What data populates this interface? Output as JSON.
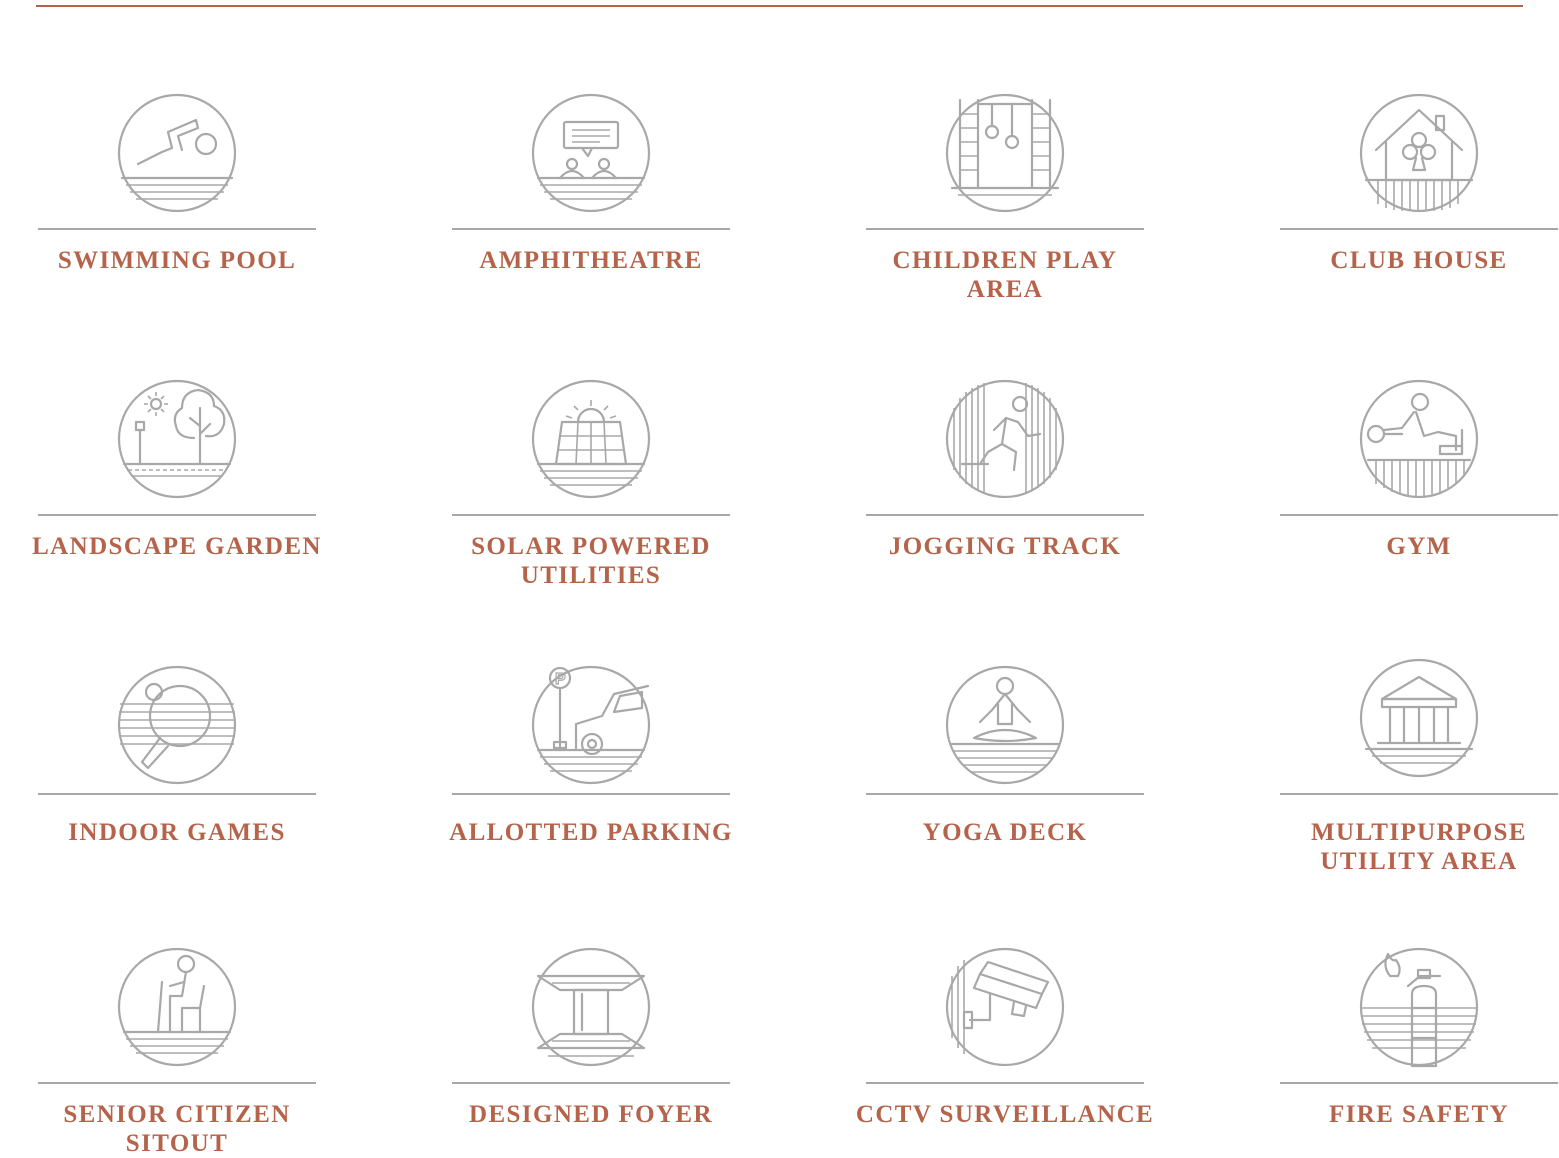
{
  "accent_color": "#b5634a",
  "icon_color": "#a8a8a8",
  "amenities": [
    {
      "label": "SWIMMING POOL",
      "icon": "swimming-icon"
    },
    {
      "label": "AMPHITHEATRE",
      "icon": "amphitheatre-icon"
    },
    {
      "label": "CHILDREN PLAY AREA",
      "icon": "children-play-icon"
    },
    {
      "label": "CLUB HOUSE",
      "icon": "club-house-icon"
    },
    {
      "label": "LANDSCAPE GARDEN",
      "icon": "landscape-garden-icon"
    },
    {
      "label": "SOLAR POWERED\nUTILITIES",
      "icon": "solar-panel-icon"
    },
    {
      "label": "JOGGING TRACK",
      "icon": "jogging-icon"
    },
    {
      "label": "GYM",
      "icon": "gym-icon"
    },
    {
      "label": "INDOOR GAMES",
      "icon": "table-tennis-icon"
    },
    {
      "label": "ALLOTTED PARKING",
      "icon": "parking-icon"
    },
    {
      "label": "YOGA DECK",
      "icon": "yoga-icon"
    },
    {
      "label": "MULTIPURPOSE\nUTILITY AREA",
      "icon": "pavilion-icon"
    },
    {
      "label": "SENIOR CITIZEN SITOUT",
      "icon": "senior-citizen-icon"
    },
    {
      "label": "DESIGNED FOYER",
      "icon": "foyer-icon"
    },
    {
      "label": "CCTV SURVEILLANCE",
      "icon": "cctv-camera-icon"
    },
    {
      "label": "FIRE SAFETY",
      "icon": "fire-extinguisher-icon"
    }
  ]
}
